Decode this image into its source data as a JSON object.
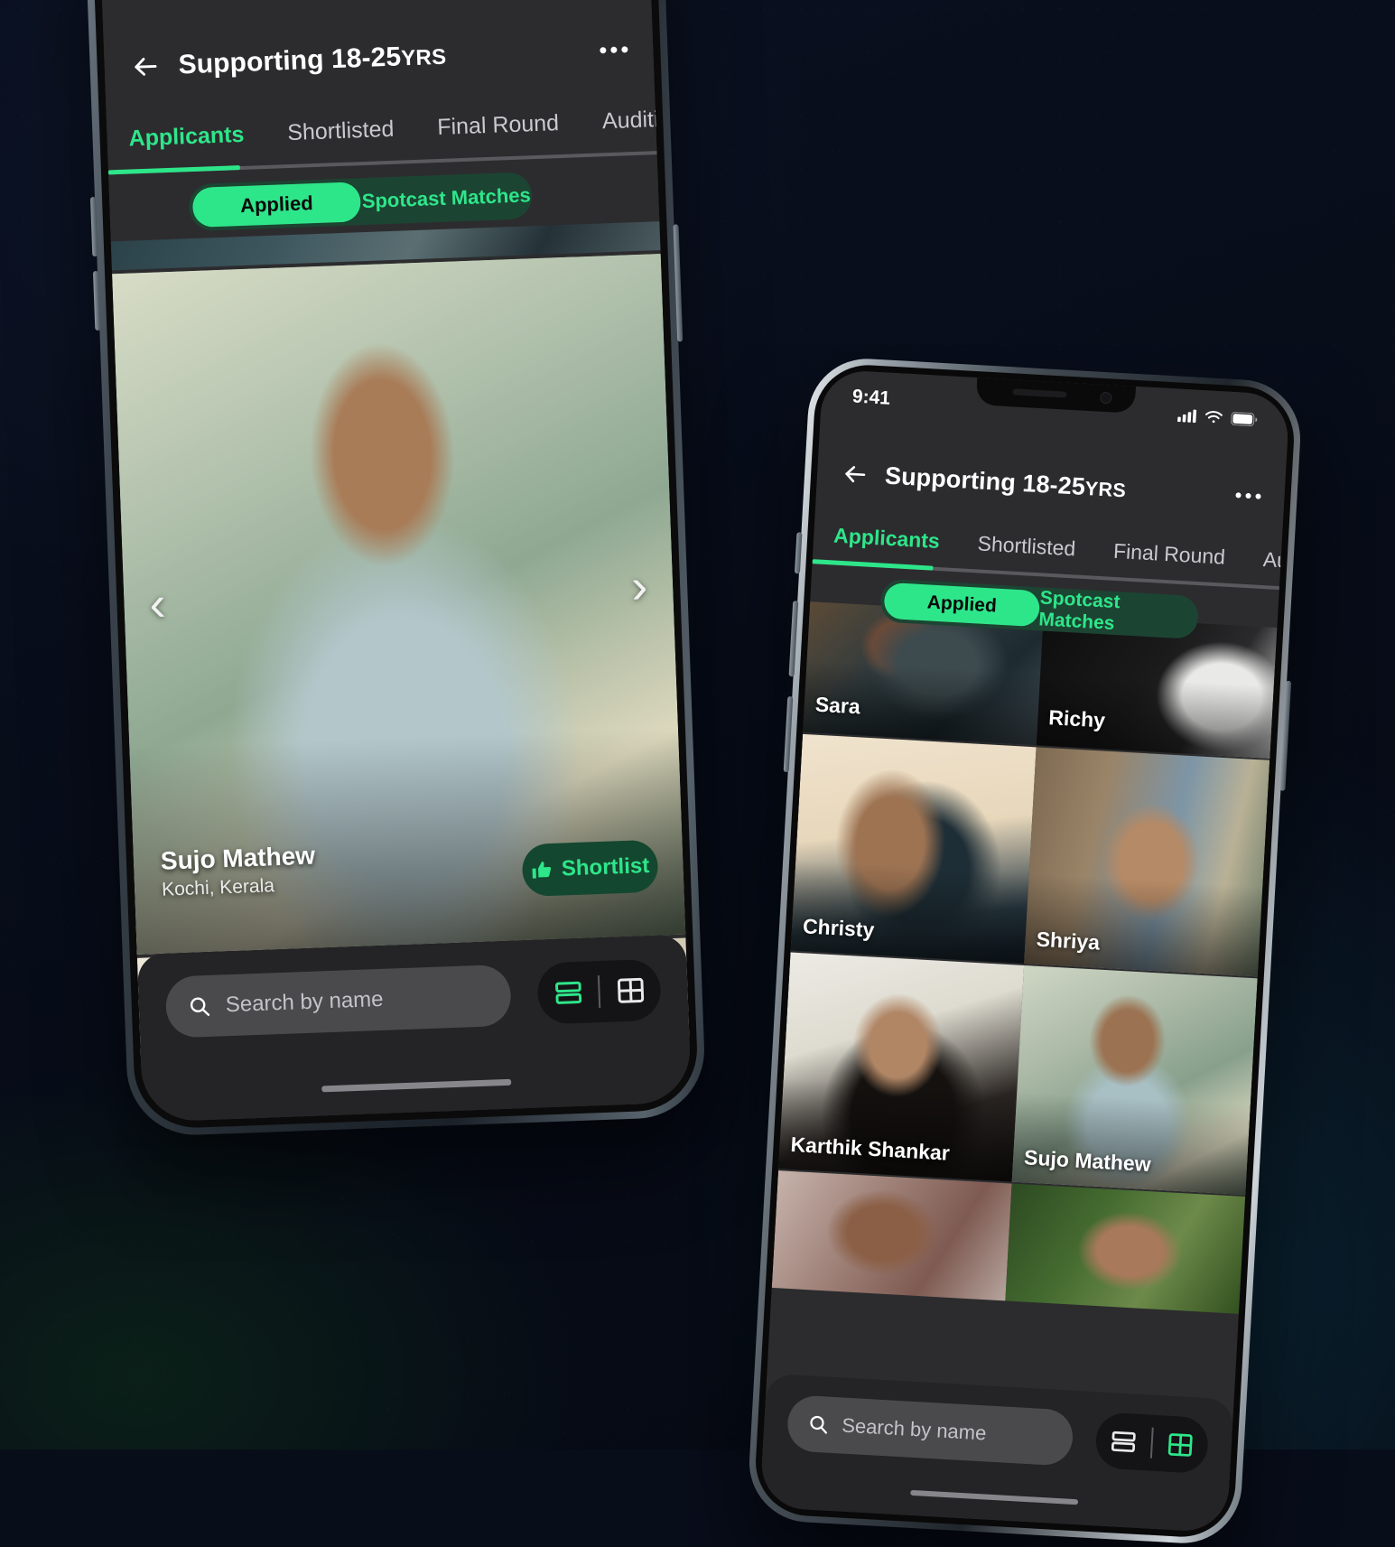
{
  "app": {
    "title_main": "Supporting 18-25",
    "title_suffix": "YRS",
    "back_icon": "back-arrow-icon",
    "more_icon": "more-options-icon"
  },
  "status_bar": {
    "time": "9:41",
    "cellular_icon": "cellular-signal-icon",
    "wifi_icon": "wifi-icon",
    "battery_icon": "battery-icon"
  },
  "tabs": [
    {
      "label": "Applicants",
      "active": true
    },
    {
      "label": "Shortlisted",
      "active": false
    },
    {
      "label": "Final Round",
      "active": false
    },
    {
      "label": "Audition",
      "active": false
    }
  ],
  "segmented": {
    "selected": "Applied",
    "unselected": "Spotcast Matches"
  },
  "bottom_bar": {
    "search_placeholder": "Search by name",
    "search_value": "",
    "search_icon": "search-icon",
    "list_view_icon": "list-view-icon",
    "grid_view_icon": "grid-view-icon"
  },
  "left_phone": {
    "active_view": "list",
    "carousel": {
      "prev_icon": "chevron-left-icon",
      "next_icon": "chevron-right-icon"
    },
    "hero_card": {
      "name": "Sujo Mathew",
      "location": "Kochi, Kerala",
      "shortlist_label": "Shortlist",
      "shortlist_icon": "thumbs-up-icon"
    }
  },
  "right_phone": {
    "active_view": "grid",
    "grid_items": [
      {
        "name": "Sara",
        "photo": "p-sara"
      },
      {
        "name": "Richy",
        "photo": "p-richy"
      },
      {
        "name": "Christy",
        "photo": "p-christy"
      },
      {
        "name": "Shriya",
        "photo": "p-shriya"
      },
      {
        "name": "Karthik Shankar",
        "photo": "p-karthik"
      },
      {
        "name": "Sujo Mathew",
        "photo": "p-sujo"
      }
    ]
  },
  "colors": {
    "accent_green": "#2EE68A",
    "accent_green_dark": "#14472F",
    "app_background": "#2C2C2E",
    "page_background": "#080D1A"
  }
}
